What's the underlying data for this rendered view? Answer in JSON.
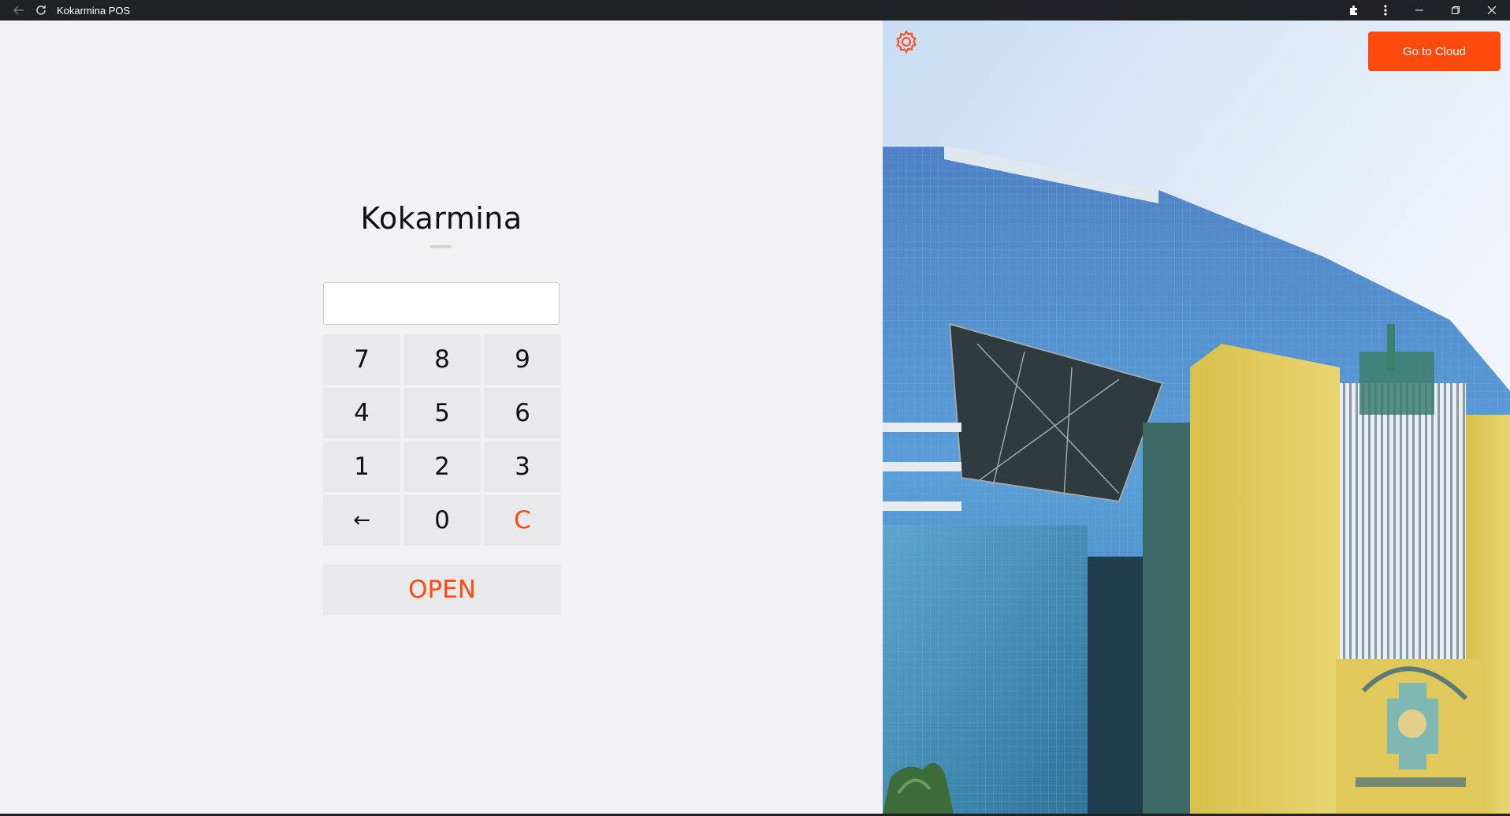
{
  "window": {
    "title": "Kokarmina POS",
    "back_icon": "arrow-left-icon",
    "reload_icon": "reload-icon",
    "extensions_icon": "puzzle-icon",
    "menu_icon": "more-vertical-icon",
    "minimize_icon": "minimize-icon",
    "restore_icon": "restore-icon",
    "close_icon": "close-icon"
  },
  "login": {
    "brand": "Kokarmina",
    "pin_value": "",
    "keys": [
      "7",
      "8",
      "9",
      "4",
      "5",
      "6",
      "1",
      "2",
      "3",
      "←",
      "0",
      "C"
    ],
    "open_label": "OPEN"
  },
  "toolbar": {
    "settings_icon": "gear-icon",
    "cloud_label": "Go to Cloud"
  },
  "colors": {
    "accent": "#ff4a0d",
    "titlebar": "#202124",
    "background": "#f2f2f4",
    "key_bg": "#e9e9ec"
  }
}
